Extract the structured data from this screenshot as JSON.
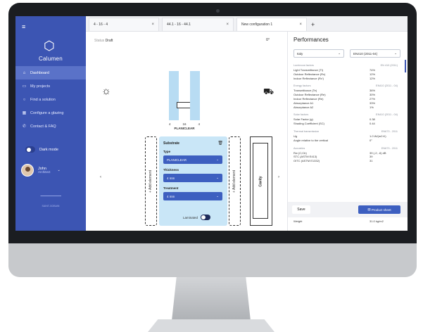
{
  "sidebar": {
    "logo_text": "Calumen",
    "items": [
      {
        "icon": "home-icon",
        "label": "Dashboard",
        "active": true
      },
      {
        "icon": "folder-icon",
        "label": "My projects"
      },
      {
        "icon": "search-icon",
        "label": "Find a solution"
      },
      {
        "icon": "grid-icon",
        "label": "Configure a glazing"
      },
      {
        "icon": "phone-icon",
        "label": "Contact & FAQ"
      }
    ],
    "dark_mode_label": "Dark mode",
    "user": {
      "name": "John",
      "company": "Architect"
    },
    "footer_text": "SAINT-GOBAIN"
  },
  "tabs": [
    {
      "label": "4 - 16 - 4",
      "close": "×"
    },
    {
      "label": "44.1 - 16 - 44.1",
      "close": "×"
    },
    {
      "label": "New configuration 1",
      "close": "×",
      "active": true
    }
  ],
  "tab_add": "+",
  "canvas": {
    "status_label": "Status",
    "status_value": "Draft",
    "angle": "0°",
    "dims": [
      "4",
      "16",
      "4"
    ],
    "glass_label": "PLANICLEAR",
    "add_element": "+ Add element",
    "cavity_label": "Cavity",
    "substrate": {
      "title": "Substrate",
      "type_label": "Type",
      "type_value": "PLANICLEAR",
      "thickness_label": "Thickness",
      "thickness_value": "4 mm",
      "treatment_label": "Treatment",
      "treatment_value": "4 mm",
      "laminated_label": "Laminated"
    }
  },
  "perf": {
    "title": "Performances",
    "select_country": "Italy",
    "select_standard": "EN410 (2011-04)",
    "sections": [
      {
        "head": "Luminous factors",
        "std": "EN 410 (2011)",
        "rows": [
          [
            "Light Transmittance (Tl)",
            "74%"
          ],
          [
            "Outdoor Reflectance (Rv)",
            "12%"
          ],
          [
            "Indoor Reflectance (Rv')",
            "12%"
          ]
        ]
      },
      {
        "head": "Energy factors",
        "std": "EN410 (2011 - 04)",
        "rows": [
          [
            "Transmittance (Te)",
            "36%"
          ],
          [
            "Outdoor Reflectance (Re)",
            "30%"
          ],
          [
            "Indoor Reflectance (Re)",
            "27%"
          ],
          [
            "Absorptance A1",
            "33%"
          ],
          [
            "Absorptance A2",
            "1%"
          ]
        ]
      },
      {
        "head": "Solar factors",
        "std": "EN410 (2011 - 04)",
        "rows": [
          [
            "Solar Factor (g)",
            "0.38"
          ],
          [
            "Shading Coefficient (SC)",
            "0.44"
          ]
        ]
      },
      {
        "head": "Thermal transmission",
        "std": "EN673 - 2011",
        "rows": [
          [
            "Ug",
            "1.0 W/(m2.K)"
          ],
          [
            "Angle relative to the vertical",
            "0°"
          ]
        ]
      },
      {
        "head": "Acoustics",
        "std": "EN673 - 2011",
        "rows": [
          [
            "Rw (C;Ctr)",
            "39 (-2; -6) dB"
          ],
          [
            "STC (ASTM E413)",
            "39"
          ],
          [
            "OITC (ASTM E1332)",
            "31"
          ]
        ]
      }
    ],
    "weight_label": "Weight",
    "weight_value": "31.0 kg/m2",
    "save_label": "Save",
    "product_button": "Product sheet"
  },
  "colors": {
    "sidebar": "#3c55b3",
    "accent": "#3d5fc0",
    "glass": "#b8dcf3",
    "substrate": "#c9e6f7"
  }
}
